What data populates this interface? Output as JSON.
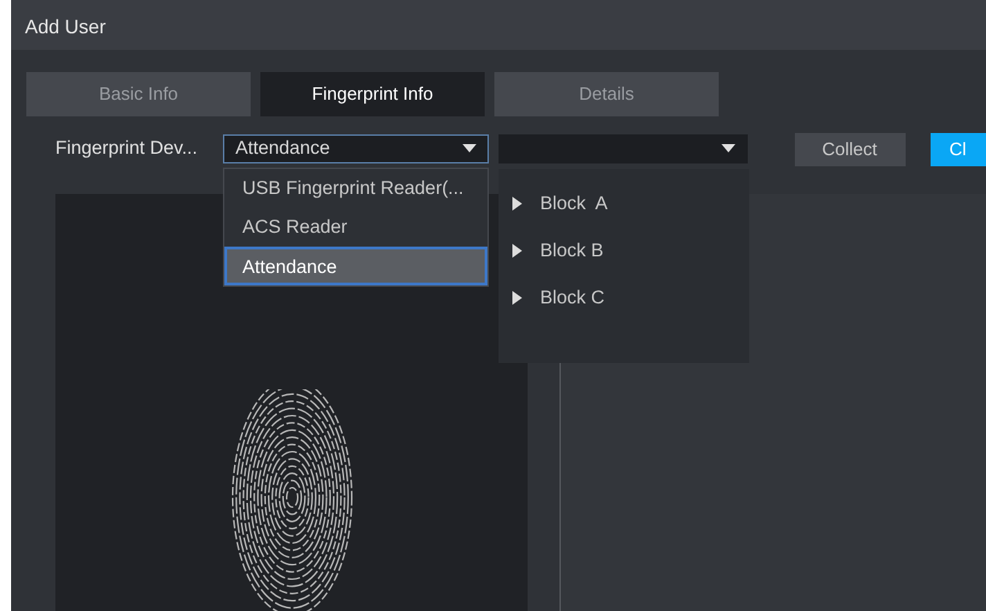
{
  "window": {
    "title": "Add User"
  },
  "tabs": [
    {
      "label": "Basic Info",
      "selected": false
    },
    {
      "label": "Fingerprint Info",
      "selected": true
    },
    {
      "label": "Details",
      "selected": false
    }
  ],
  "device_row": {
    "label": "Fingerprint Dev...",
    "device_select": {
      "value": "Attendance",
      "expanded": true
    },
    "block_select": {
      "expanded": true
    },
    "buttons": [
      {
        "label": "Collect",
        "kind": "secondary"
      },
      {
        "label": "Cl",
        "kind": "primary"
      }
    ]
  },
  "device_options": [
    {
      "label": "USB Fingerprint Reader(...",
      "selected": false
    },
    {
      "label": "ACS Reader",
      "selected": false
    },
    {
      "label": "Attendance",
      "selected": true
    }
  ],
  "block_tree": [
    {
      "label": "Block  A",
      "expanded": false
    },
    {
      "label": "Block B",
      "expanded": false
    },
    {
      "label": "Block C",
      "expanded": false
    }
  ]
}
